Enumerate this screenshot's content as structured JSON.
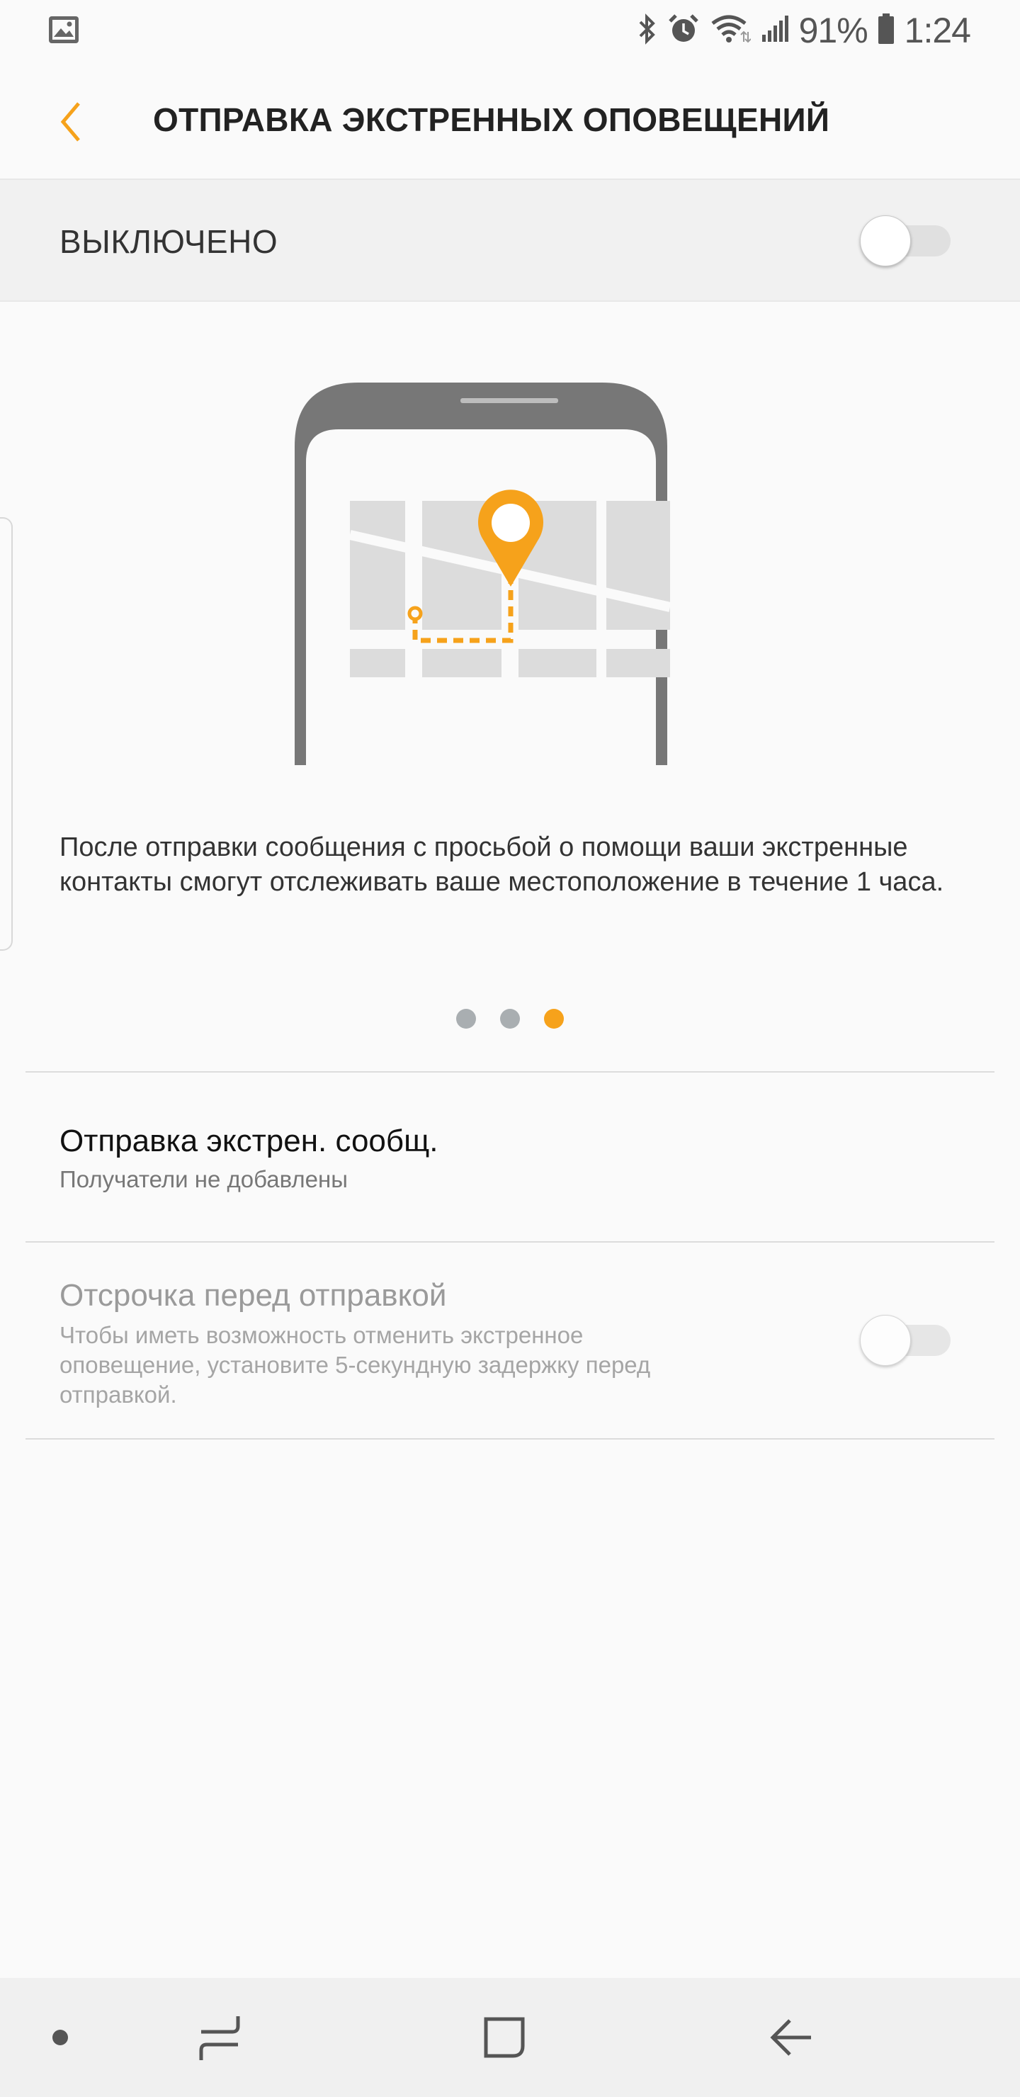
{
  "status_bar": {
    "battery_text": "91%",
    "time": "1:24",
    "icons": [
      "gallery-icon",
      "bluetooth-icon",
      "alarm-icon",
      "wifi-icon",
      "signal-icon",
      "battery-icon"
    ]
  },
  "header": {
    "title": "ОТПРАВКА ЭКСТРЕННЫХ ОПОВЕЩЕНИЙ"
  },
  "master_switch": {
    "label": "ВЫКЛЮЧЕНО",
    "on": false
  },
  "description": "После отправки сообщения с просьбой о помощи ваши экстренные контакты смогут отслеживать ваше местоположение в течение 1 часа.",
  "page_indicator": {
    "count": 3,
    "active_index": 2
  },
  "items": [
    {
      "title": "Отправка экстрен. сообщ.",
      "subtitle": "Получатели не добавлены"
    },
    {
      "title": "Отсрочка перед отправкой",
      "subtitle": "Чтобы иметь возможность отменить экстренное оповещение, установите 5-секундную задержку перед отправкой.",
      "enabled": false,
      "switch_on": false
    }
  ],
  "colors": {
    "accent": "#f6a21b",
    "background": "#fafafa",
    "switch_bar": "#f1f1f1",
    "phone_body": "#777777",
    "map_block": "#dcdcdc"
  },
  "navbar": {
    "items": [
      "dot-icon",
      "recents-icon",
      "home-icon",
      "back-arrow-icon"
    ]
  }
}
